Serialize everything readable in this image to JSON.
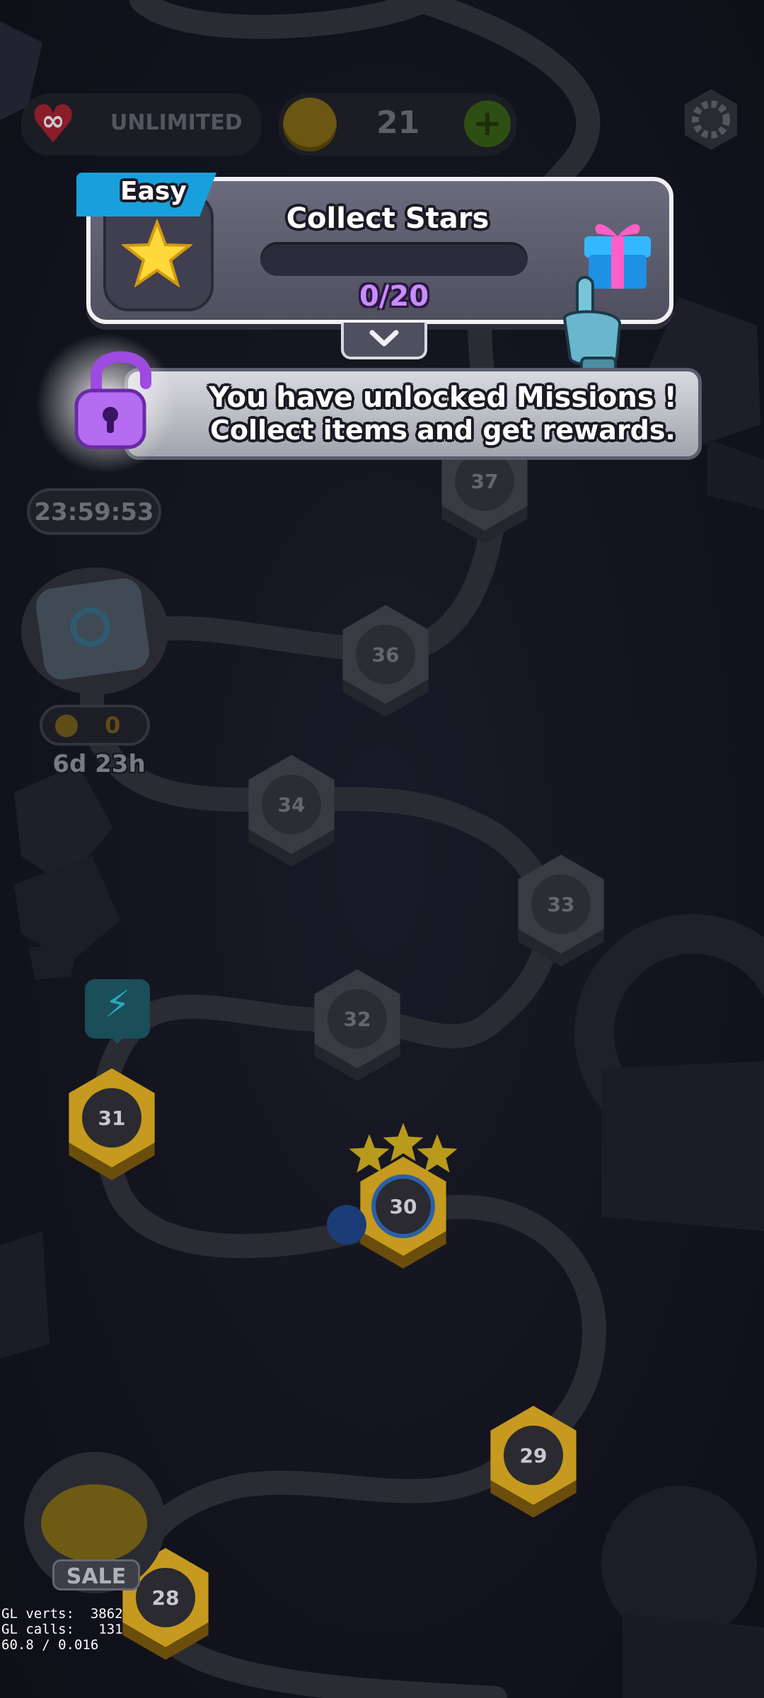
{
  "hud": {
    "lives_text": "UNLIMITED",
    "coins": "21"
  },
  "mission": {
    "difficulty": "Easy",
    "title": "Collect Stars",
    "progress_text": "0/20",
    "progress_fraction": 0.0
  },
  "unlock_banner": {
    "line1": "You have unlocked Missions !",
    "line2": "Collect items and get rewards."
  },
  "side_events": {
    "timer1": "23:59:53",
    "event2_count": "0",
    "event2_timer": "6d 23h",
    "sale_label": "SALE"
  },
  "levels": [
    "37",
    "36",
    "34",
    "33",
    "32",
    "31",
    "30",
    "29",
    "28"
  ],
  "debug": {
    "line1": "GL verts:  3862",
    "line2": "GL calls:   131",
    "line3": "60.8 / 0.016"
  },
  "colors": {
    "background": "#151521",
    "path": "#2c2c36",
    "node_gold": "#c59a1e",
    "node_dark": "#3a3a42",
    "mission_purple": "#b15cff",
    "easy_tab": "#1aa3e0"
  }
}
